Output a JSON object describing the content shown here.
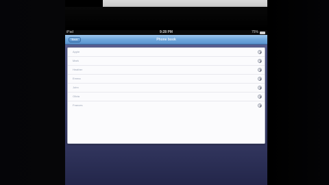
{
  "statusbar": {
    "device": "iPad",
    "time": "9:28 PM",
    "battery": "75%"
  },
  "navbar": {
    "back_label": "Back",
    "title": "Phone book"
  },
  "list": {
    "items": [
      {
        "label": "Apple"
      },
      {
        "label": "Mark"
      },
      {
        "label": "Heather"
      },
      {
        "label": "Emma"
      },
      {
        "label": "John"
      },
      {
        "label": "Olivia"
      },
      {
        "label": "Frances"
      }
    ]
  }
}
